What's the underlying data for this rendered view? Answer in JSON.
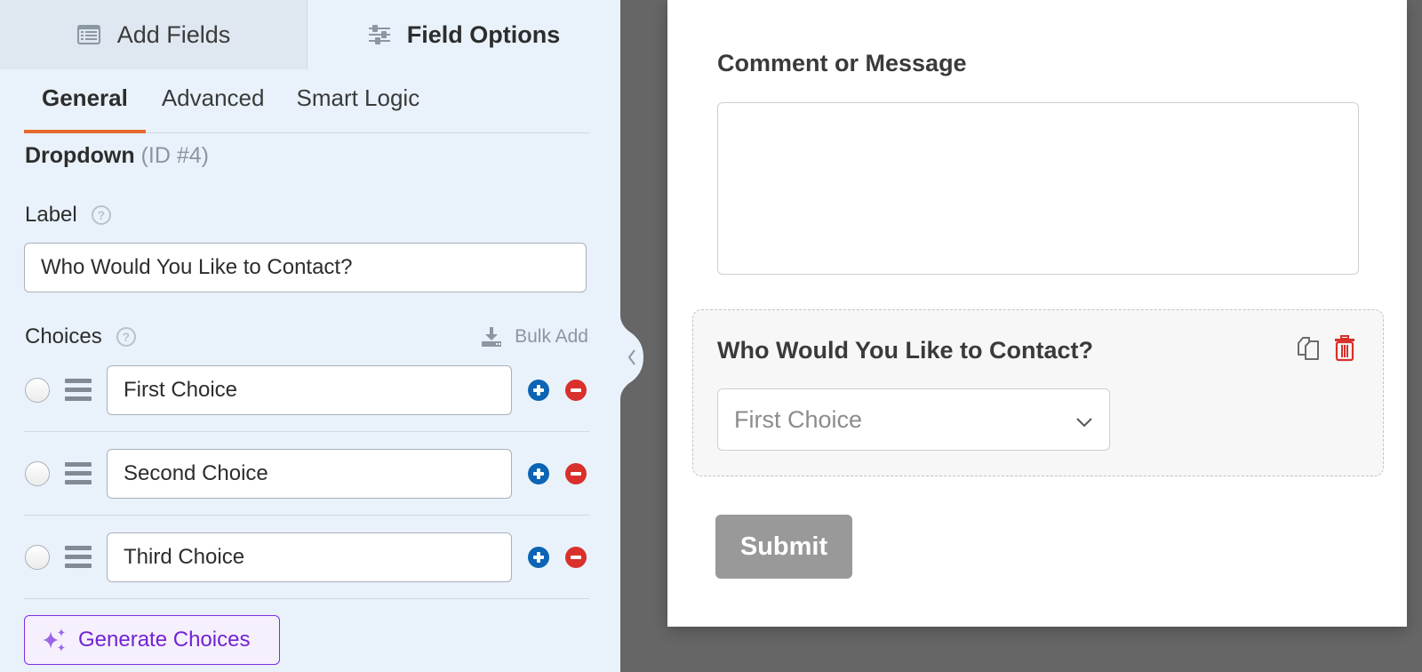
{
  "left_panel": {
    "top_tabs": [
      {
        "label": "Add Fields",
        "icon": "form-list-icon",
        "active": false
      },
      {
        "label": "Field Options",
        "icon": "sliders-icon",
        "active": true
      }
    ],
    "sub_tabs": [
      {
        "label": "General",
        "active": true
      },
      {
        "label": "Advanced",
        "active": false
      },
      {
        "label": "Smart Logic",
        "active": false
      }
    ],
    "field_type": "Dropdown",
    "field_id": "(ID #4)",
    "label_section": {
      "label": "Label",
      "help_icon": "?",
      "value": "Who Would You Like to Contact?"
    },
    "choices_section": {
      "label": "Choices",
      "help_icon": "?",
      "bulk_add_label": "Bulk Add",
      "choices": [
        {
          "value": "First Choice",
          "selected": false
        },
        {
          "value": "Second Choice",
          "selected": false
        },
        {
          "value": "Third Choice",
          "selected": false
        }
      ]
    },
    "generate_button_label": "Generate Choices"
  },
  "canvas": {
    "comment_field_label": "Comment or Message",
    "comment_field_value": "",
    "dropdown_field_label": "Who Would You Like to Contact?",
    "dropdown_selected": "First Choice",
    "submit_label": "Submit"
  },
  "colors": {
    "accent_tab": "#e56a2d",
    "add_choice": "#0b64b4",
    "remove_choice": "#d9302b",
    "generate_purple": "#7123d3",
    "delete_red": "#d9302b"
  }
}
